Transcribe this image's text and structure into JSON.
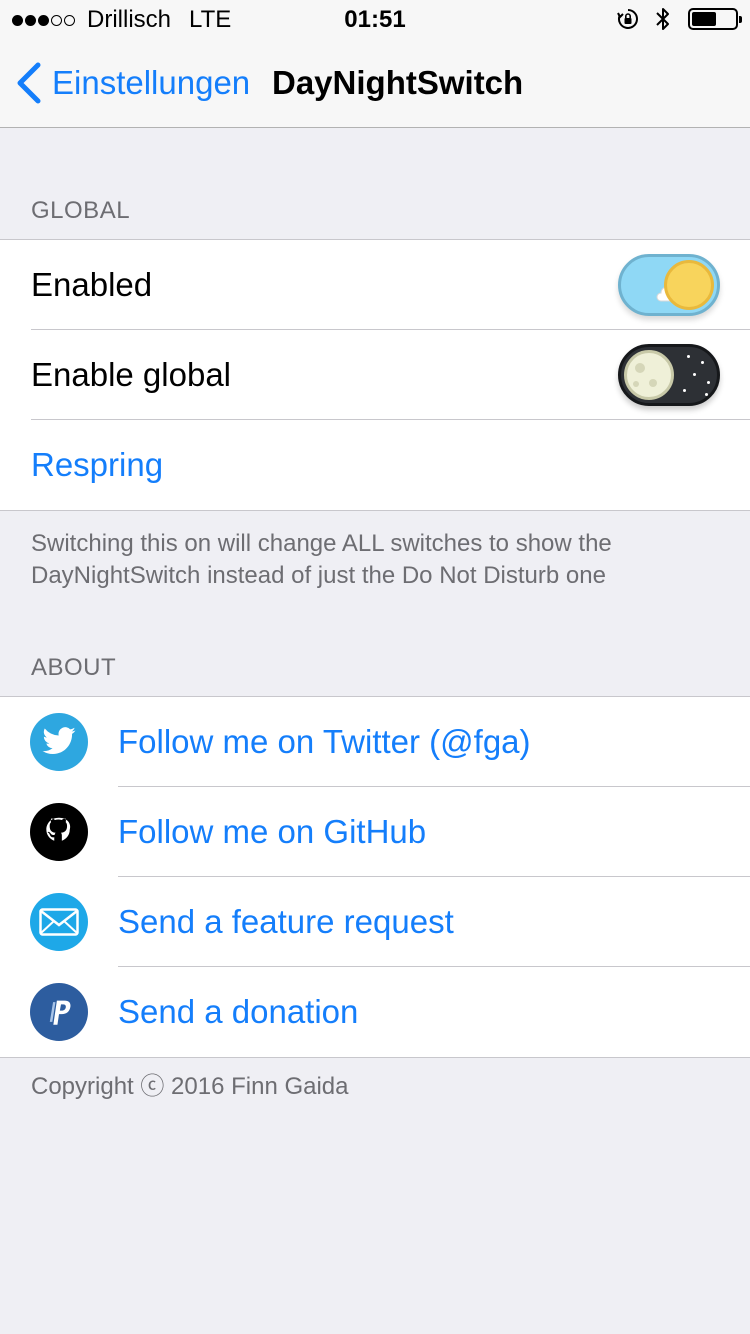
{
  "status_bar": {
    "carrier": "Drillisch",
    "network": "LTE",
    "time": "01:51",
    "signal_dots_filled": 3,
    "signal_dots_total": 5,
    "icons": [
      "orientation-lock-icon",
      "bluetooth-icon",
      "battery-icon"
    ]
  },
  "nav": {
    "back_label": "Einstellungen",
    "title": "DayNightSwitch"
  },
  "global": {
    "header": "GLOBAL",
    "rows": [
      {
        "label": "Enabled",
        "switch_state": "day"
      },
      {
        "label": "Enable global",
        "switch_state": "night"
      },
      {
        "label": "Respring"
      }
    ],
    "footer": "Switching this on will change ALL switches to show the DayNightSwitch instead of just the Do Not Disturb one"
  },
  "about": {
    "header": "ABOUT",
    "rows": [
      {
        "label": "Follow me on Twitter (@fga)",
        "icon": "twitter-icon",
        "color": "#2ea7e0"
      },
      {
        "label": "Follow me on GitHub",
        "icon": "github-icon",
        "color": "#000000"
      },
      {
        "label": "Send a feature request",
        "icon": "mail-icon",
        "color": "#1ea8e8"
      },
      {
        "label": "Send a donation",
        "icon": "paypal-icon",
        "color": "#2d5d9f"
      }
    ],
    "copyright": "Copyright ⓒ 2016 Finn Gaida"
  },
  "colors": {
    "accent": "#147efb",
    "background": "#efeff4",
    "secondary_text": "#6d6d72"
  }
}
